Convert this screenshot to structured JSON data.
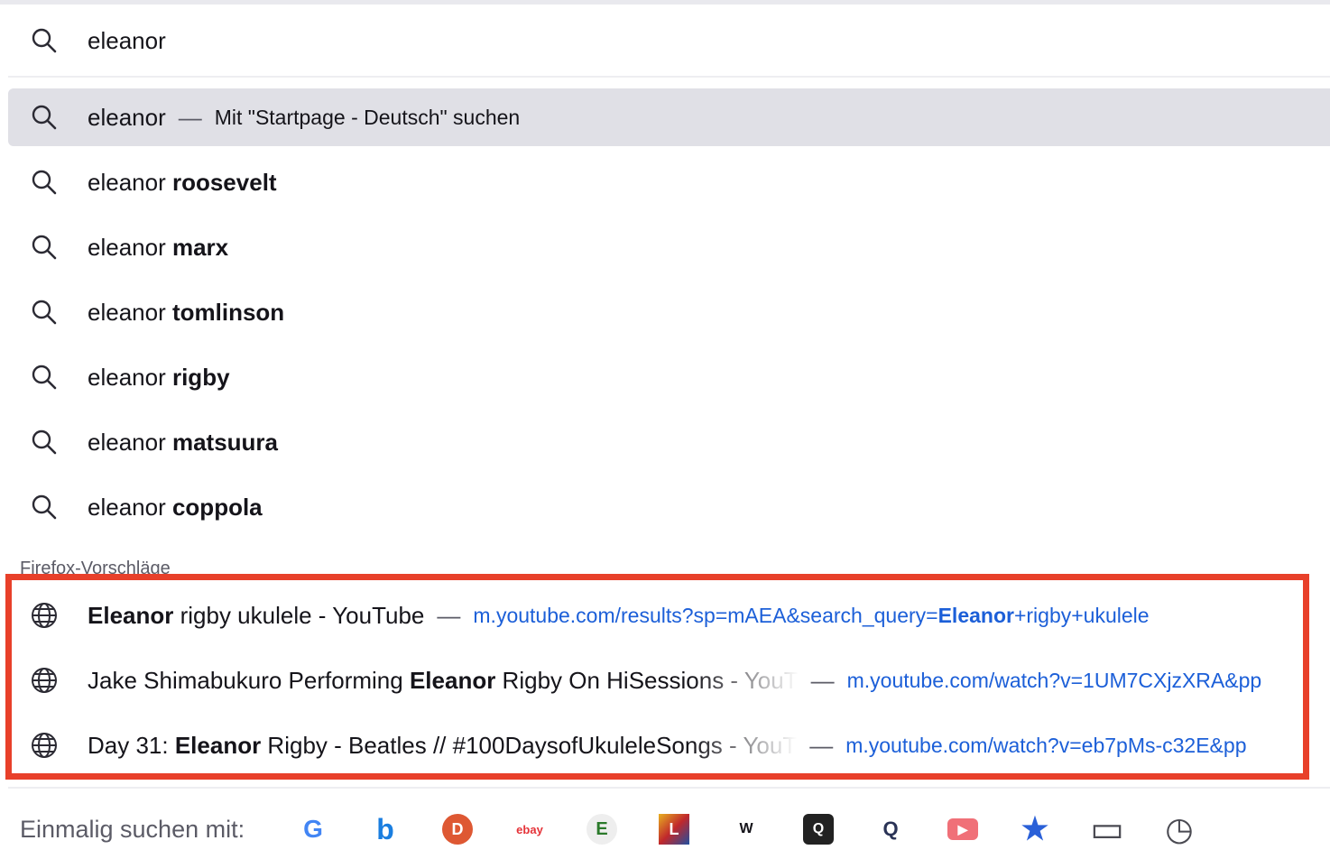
{
  "search": {
    "value": "eleanor"
  },
  "primary": {
    "query": "eleanor",
    "sep": "—",
    "action": "Mit \"Startpage - Deutsch\" suchen"
  },
  "suggestions": [
    {
      "prefix": "eleanor ",
      "bold": "roosevelt"
    },
    {
      "prefix": "eleanor ",
      "bold": "marx"
    },
    {
      "prefix": "eleanor ",
      "bold": "tomlinson"
    },
    {
      "prefix": "eleanor ",
      "bold": "rigby"
    },
    {
      "prefix": "eleanor ",
      "bold": "matsuura"
    },
    {
      "prefix": "eleanor ",
      "bold": "coppola"
    }
  ],
  "firefox_heading": "Firefox-Vorschläge",
  "results": [
    {
      "pre": "",
      "bold": "Eleanor",
      "post": " rigby ukulele - YouTube",
      "sep": "—",
      "url_pre": "m.youtube.com/results?sp=mAEA&search_query=",
      "url_bold": "Eleanor",
      "url_post": "+rigby+ukulele"
    },
    {
      "pre": "Jake Shimabukuro Performing ",
      "bold": "Eleanor",
      "post": " Rigby On HiSessions - YouT",
      "sep": "—",
      "url_pre": "m.youtube.com/watch?v=1UM7CXjzXRA&pp",
      "url_bold": "",
      "url_post": ""
    },
    {
      "pre": "Day 31: ",
      "bold": "Eleanor",
      "post": " Rigby - Beatles // #100DaysofUkuleleSongs - YouT",
      "sep": "—",
      "url_pre": "m.youtube.com/watch?v=eb7pMs-c32E&pp",
      "url_bold": "",
      "url_post": ""
    }
  ],
  "footer": {
    "label": "Einmalig suchen mit:",
    "engines": [
      {
        "name": "google",
        "glyph": "G"
      },
      {
        "name": "bing",
        "glyph": "b"
      },
      {
        "name": "duckduckgo",
        "glyph": "D"
      },
      {
        "name": "ebay",
        "glyph": "ebay"
      },
      {
        "name": "ecosia",
        "glyph": "E"
      },
      {
        "name": "leo",
        "glyph": "L"
      },
      {
        "name": "wikipedia",
        "glyph": "W"
      },
      {
        "name": "qwant",
        "glyph": "Q"
      },
      {
        "name": "startpage",
        "glyph": "Q"
      },
      {
        "name": "youtube-add",
        "glyph": "▶"
      },
      {
        "name": "bookmarks",
        "glyph": "★"
      },
      {
        "name": "tabs",
        "glyph": "▭"
      },
      {
        "name": "history",
        "glyph": "◷"
      }
    ]
  },
  "colors": {
    "accent": "#1c5fd8",
    "highlight": "#e8402a",
    "selected_bg": "#e0e0e6"
  }
}
